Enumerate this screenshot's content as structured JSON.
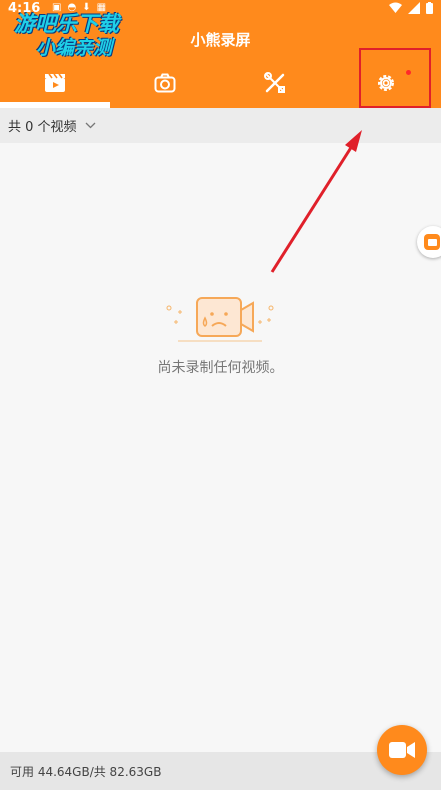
{
  "status_bar": {
    "time": "4:16",
    "icons": [
      "notification-icon",
      "android-icon",
      "download-icon",
      "a-icon"
    ],
    "right_icons": [
      "wifi-icon",
      "signal-icon",
      "battery-icon"
    ]
  },
  "watermark": {
    "line1": "游吧乐下载",
    "line2": "小编亲测"
  },
  "header": {
    "title": "小熊录屏",
    "tabs": [
      {
        "icon": "video-clapper-icon",
        "active": true
      },
      {
        "icon": "camera-icon",
        "active": false
      },
      {
        "icon": "tools-icon",
        "active": false
      },
      {
        "icon": "settings-gear-icon",
        "active": false,
        "has_badge": true
      }
    ]
  },
  "filter": {
    "label": "共 0 个视频",
    "icon": "chevron-down-icon"
  },
  "empty_state": {
    "message": "尚未录制任何视频。",
    "icon": "sad-camera-icon"
  },
  "footer": {
    "storage": "可用 44.64GB/共 82.63GB"
  },
  "fab": {
    "icon": "video-camera-icon"
  },
  "colors": {
    "primary": "#ff8a1c",
    "annotation": "#e0202a",
    "badge": "#ff2a2a"
  }
}
